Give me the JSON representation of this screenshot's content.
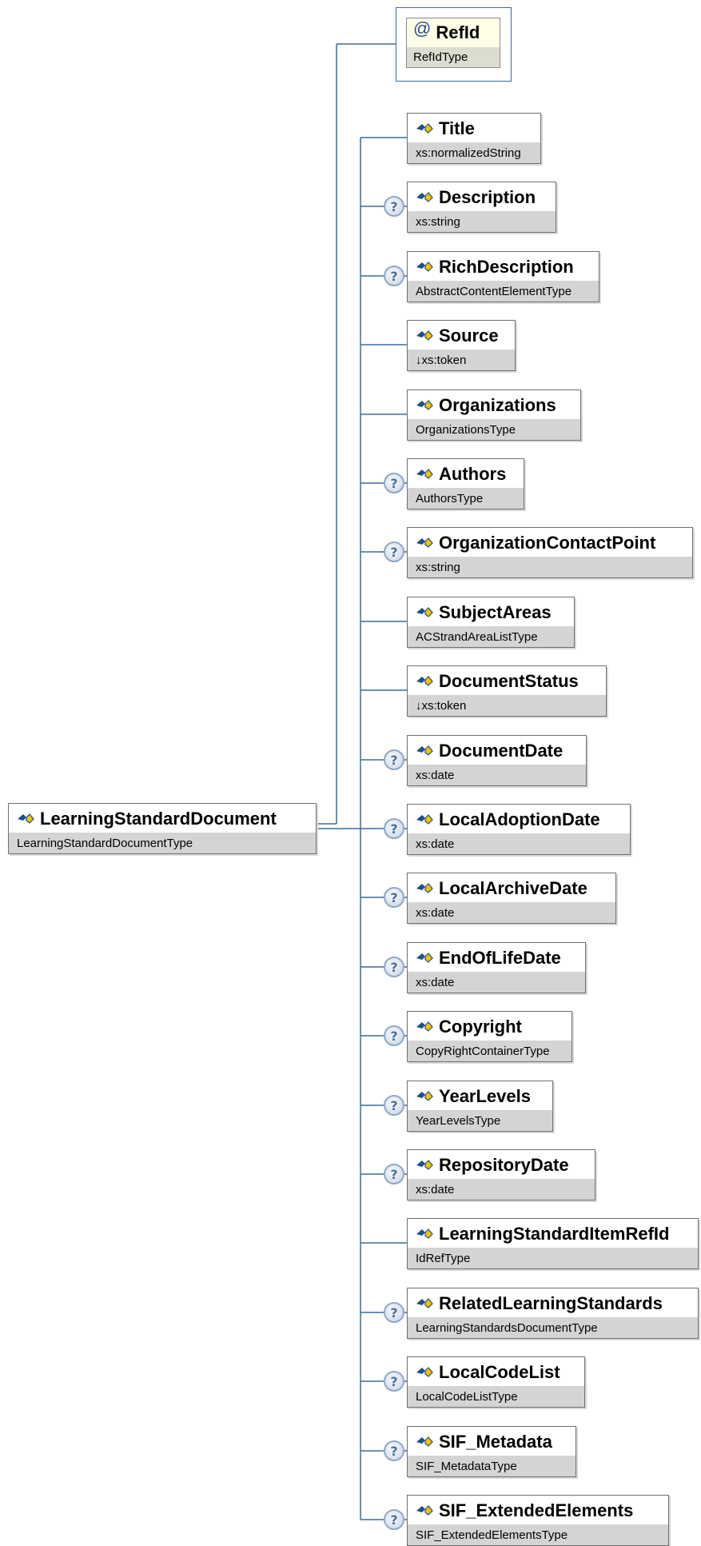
{
  "colors": {
    "line": "#3e6c9a",
    "type_band": "#d4d4d4",
    "attr_fill": "#ffffe8",
    "icon_blue": "#1f4e8c",
    "icon_yellow": "#f2c200"
  },
  "icons": {
    "element": "element-diamond-icon",
    "attribute": "at-sign-icon",
    "optional": "question-mark-icon"
  },
  "root": {
    "name": "LearningStandardDocument",
    "type": "LearningStandardDocumentType"
  },
  "attribute": {
    "symbol": "@",
    "name": "RefId",
    "type": "RefIdType"
  },
  "optional_symbol": "?",
  "children": [
    {
      "name": "Title",
      "type": "xs:normalizedString",
      "optional": false
    },
    {
      "name": "Description",
      "type": "xs:string",
      "optional": true
    },
    {
      "name": "RichDescription",
      "type": "AbstractContentElementType",
      "optional": true
    },
    {
      "name": "Source",
      "type": "↓xs:token",
      "optional": false
    },
    {
      "name": "Organizations",
      "type": "OrganizationsType",
      "optional": false
    },
    {
      "name": "Authors",
      "type": "AuthorsType",
      "optional": true
    },
    {
      "name": "OrganizationContactPoint",
      "type": "xs:string",
      "optional": true
    },
    {
      "name": "SubjectAreas",
      "type": "ACStrandAreaListType",
      "optional": false
    },
    {
      "name": "DocumentStatus",
      "type": "↓xs:token",
      "optional": false
    },
    {
      "name": "DocumentDate",
      "type": "xs:date",
      "optional": true
    },
    {
      "name": "LocalAdoptionDate",
      "type": "xs:date",
      "optional": true
    },
    {
      "name": "LocalArchiveDate",
      "type": "xs:date",
      "optional": true
    },
    {
      "name": "EndOfLifeDate",
      "type": "xs:date",
      "optional": true
    },
    {
      "name": "Copyright",
      "type": "CopyRightContainerType",
      "optional": true
    },
    {
      "name": "YearLevels",
      "type": "YearLevelsType",
      "optional": true
    },
    {
      "name": "RepositoryDate",
      "type": "xs:date",
      "optional": true
    },
    {
      "name": "LearningStandardItemRefId",
      "type": "IdRefType",
      "optional": false
    },
    {
      "name": "RelatedLearningStandards",
      "type": "LearningStandardsDocumentType",
      "optional": true
    },
    {
      "name": "LocalCodeList",
      "type": "LocalCodeListType",
      "optional": true
    },
    {
      "name": "SIF_Metadata",
      "type": "SIF_MetadataType",
      "optional": true
    },
    {
      "name": "SIF_ExtendedElements",
      "type": "SIF_ExtendedElementsType",
      "optional": true
    }
  ]
}
